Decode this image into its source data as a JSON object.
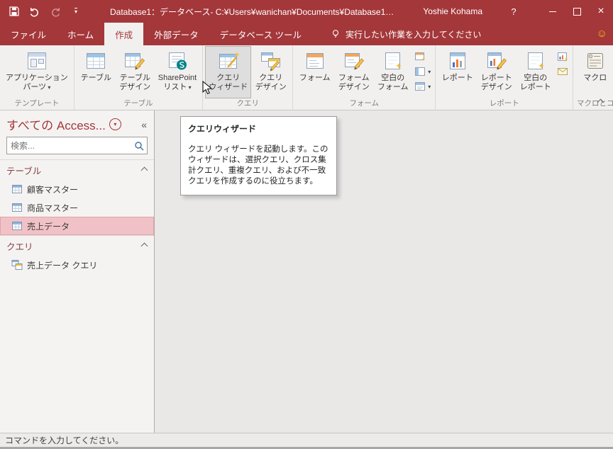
{
  "titlebar": {
    "title": "Database1：データベース- C:¥Users¥wanichan¥Documents¥Database1…",
    "user_name": "Yoshie Kohama",
    "help_label": "?"
  },
  "tabs": {
    "file": "ファイル",
    "home": "ホーム",
    "create": "作成",
    "external_data": "外部データ",
    "database_tools": "データベース ツール",
    "tell_me": "実行したい作業を入力してください"
  },
  "ribbon": {
    "templates_group": {
      "label": "テンプレート",
      "app_parts": [
        "アプリケーション",
        "パーツ"
      ]
    },
    "tables_group": {
      "label": "テーブル",
      "table": "テーブル",
      "table_design": [
        "テーブル",
        "デザイン"
      ],
      "sharepoint": [
        "SharePoint",
        "リスト"
      ]
    },
    "queries_group": {
      "label": "クエリ",
      "query_wizard": [
        "クエリ",
        "ウィザード"
      ],
      "query_design": [
        "クエリ",
        "デザイン"
      ]
    },
    "forms_group": {
      "label": "フォーム",
      "form": "フォーム",
      "form_design": [
        "フォーム",
        "デザイン"
      ],
      "blank_form": [
        "空白の",
        "フォーム"
      ]
    },
    "reports_group": {
      "label": "レポート",
      "report": "レポート",
      "report_design": [
        "レポート",
        "デザイン"
      ],
      "blank_report": [
        "空白の",
        "レポート"
      ]
    },
    "macros_group": {
      "label": "マクロとコード",
      "macro": "マクロ"
    }
  },
  "tooltip": {
    "title": "クエリウィザード",
    "body": "クエリ ウィザードを起動します。このウィザードは、選択クエリ、クロス集計クエリ、重複クエリ、および不一致クエリを作成するのに役立ちます。"
  },
  "nav_pane": {
    "title": "すべての Access...",
    "search_placeholder": "検索...",
    "tables_section": {
      "label": "テーブル",
      "items": [
        "顧客マスター",
        "商品マスター",
        "売上データ"
      ]
    },
    "queries_section": {
      "label": "クエリ",
      "items": [
        "売上データ クエリ"
      ]
    }
  },
  "status_bar": {
    "message": "コマンドを入力してください。"
  },
  "colors": {
    "accent": "#A4373A",
    "selection_bg": "#F0C2C7",
    "ribbon_bg": "#F1F0EF"
  }
}
